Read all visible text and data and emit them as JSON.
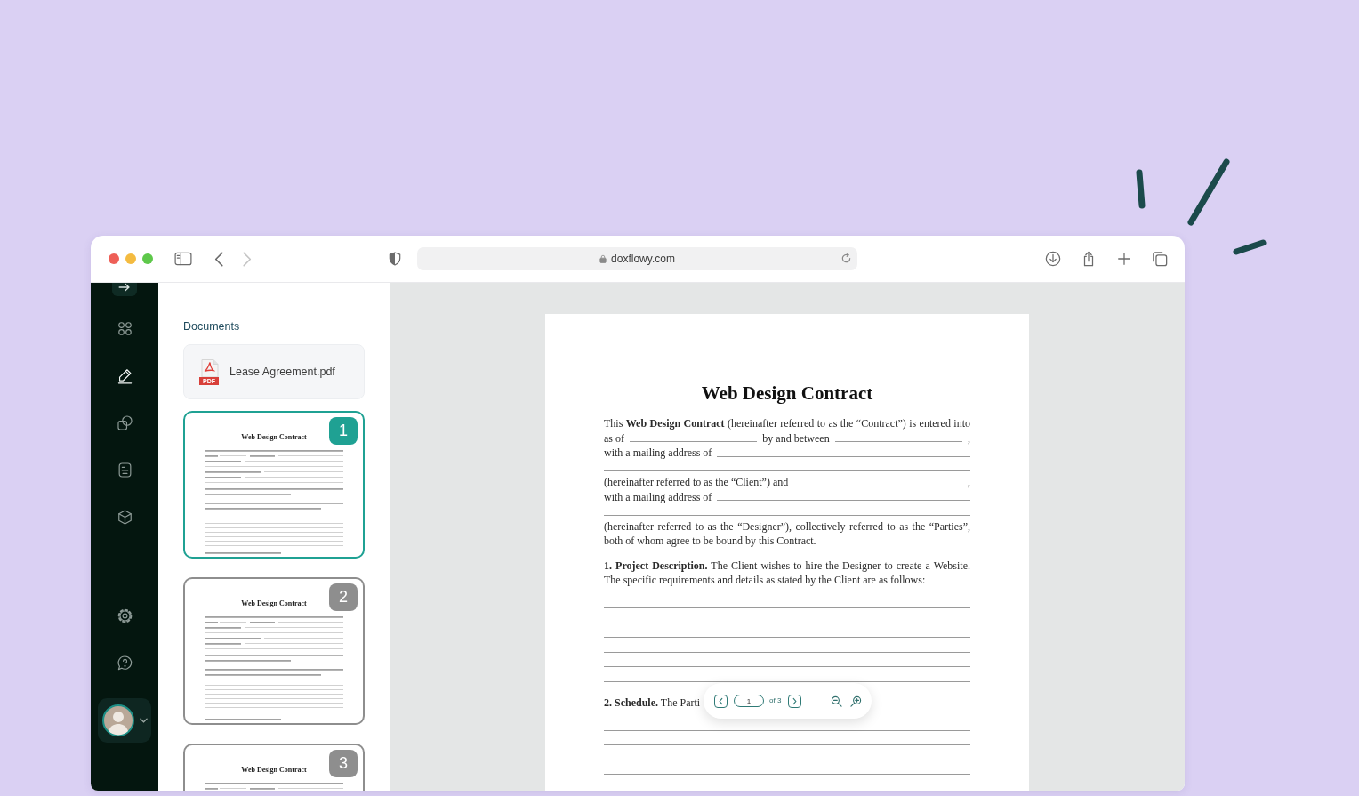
{
  "browser": {
    "navigation": [
      {
        "kind": "back",
        "disabled": false
      },
      {
        "kind": "forward",
        "disabled": true
      }
    ],
    "url": "doxflowy.com"
  },
  "sidebar": {
    "top_items": [
      {
        "kind": "grid",
        "selected": false
      },
      {
        "kind": "edit",
        "selected": true
      },
      {
        "kind": "shapes",
        "selected": false
      },
      {
        "kind": "document",
        "selected": false
      },
      {
        "kind": "cube",
        "selected": false
      }
    ],
    "bottom_items": [
      {
        "kind": "settings",
        "selected": false
      },
      {
        "kind": "help",
        "selected": false
      }
    ]
  },
  "documents": {
    "heading": "Documents",
    "file": {
      "name": "Lease Agreement.pdf",
      "type_label": "PDF"
    },
    "pages": [
      {
        "number": "1",
        "title": "Web Design Contract",
        "selected": true
      },
      {
        "number": "2",
        "title": "Web Design Contract",
        "selected": false
      },
      {
        "number": "3",
        "title": "Web Design Contract",
        "selected": false
      }
    ]
  },
  "document": {
    "title": "Web Design Contract",
    "paragraphs": [
      {
        "lines": [
          {
            "segments": [
              {
                "kind": "text",
                "text": "This **Web Design Contract** (hereinafter referred to as the “Contract”) is entered into"
              }
            ]
          },
          {
            "segments": [
              {
                "kind": "text",
                "text": "as of"
              },
              {
                "kind": "blank"
              },
              {
                "kind": "text",
                "text": "by and between"
              },
              {
                "kind": "blank"
              },
              {
                "kind": "text",
                "text": ","
              }
            ]
          },
          {
            "segments": [
              {
                "kind": "text",
                "text": "with a mailing address of"
              },
              {
                "kind": "blank"
              }
            ]
          },
          {
            "segments": [
              {
                "kind": "blank"
              }
            ]
          },
          {
            "segments": [
              {
                "kind": "text",
                "text": "(hereinafter referred to as the “Client”) and"
              },
              {
                "kind": "blank"
              },
              {
                "kind": "text",
                "text": ","
              }
            ]
          },
          {
            "segments": [
              {
                "kind": "text",
                "text": "with a mailing address of"
              },
              {
                "kind": "blank"
              }
            ]
          },
          {
            "segments": [
              {
                "kind": "blank"
              }
            ]
          },
          {
            "segments": [
              {
                "kind": "text",
                "text": "(hereinafter referred to as the “Designer”), collectively referred to as the “Parties”, both of whom agree to be bound by this Contract."
              }
            ]
          }
        ]
      },
      {
        "lines": [
          {
            "segments": [
              {
                "kind": "text",
                "text": "**1. Project Description.** The Client wishes to hire the Designer to create a Website. The specific requirements and details as stated by the Client are as follows:"
              }
            ]
          }
        ]
      },
      {
        "lines": [
          {
            "segments": [
              {
                "kind": "blank"
              }
            ]
          },
          {
            "segments": [
              {
                "kind": "blank"
              }
            ]
          },
          {
            "segments": [
              {
                "kind": "blank"
              }
            ]
          },
          {
            "segments": [
              {
                "kind": "blank"
              }
            ]
          },
          {
            "segments": [
              {
                "kind": "blank"
              }
            ]
          },
          {
            "segments": [
              {
                "kind": "blank"
              }
            ]
          }
        ]
      },
      {
        "lines": [
          {
            "segments": [
              {
                "kind": "text",
                "text": "**2. Schedule.** The Parti"
              }
            ]
          }
        ]
      },
      {
        "lines": [
          {
            "segments": [
              {
                "kind": "blank"
              }
            ]
          },
          {
            "segments": [
              {
                "kind": "blank"
              }
            ]
          },
          {
            "segments": [
              {
                "kind": "blank"
              }
            ]
          },
          {
            "segments": [
              {
                "kind": "blank"
              }
            ]
          }
        ]
      }
    ]
  },
  "pager": {
    "page": "1",
    "of_label": "of 3"
  }
}
